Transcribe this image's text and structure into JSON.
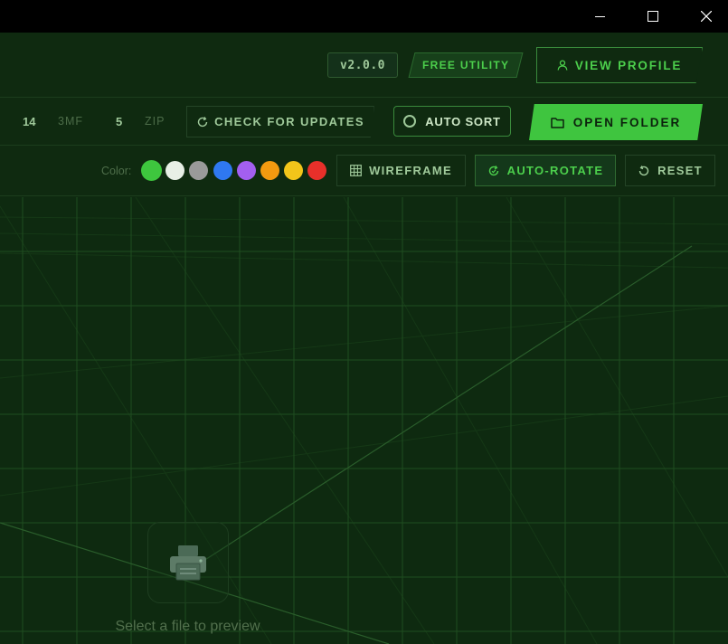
{
  "window": {
    "controls": {
      "minimize": "minimize-icon",
      "maximize": "maximize-icon",
      "close": "close-icon"
    }
  },
  "header": {
    "version": "v2.0.0",
    "badge": "FREE UTILITY",
    "profile_button": "VIEW PROFILE",
    "profile_icon": "user-icon"
  },
  "toolbar": {
    "stats": [
      {
        "count": "14",
        "label": "3MF"
      },
      {
        "count": "5",
        "label": "ZIP"
      }
    ],
    "check_updates": "CHECK FOR UPDATES",
    "auto_sort": "AUTO SORT",
    "open_folder": "OPEN FOLDER"
  },
  "viewbar": {
    "color_label": "Color:",
    "colors": [
      "#3ec63e",
      "#e8efe6",
      "#9a9a9a",
      "#2f78f0",
      "#a35ff0",
      "#f39a10",
      "#f2c51a",
      "#e8302a"
    ],
    "selected_color_index": 0,
    "wireframe": "WIREFRAME",
    "auto_rotate": "AUTO-ROTATE",
    "reset": "RESET"
  },
  "viewport": {
    "empty_icon": "printer-icon",
    "empty_text": "Select a file to preview"
  },
  "theme": {
    "accent": "#3fc53f",
    "background": "#0f2a10",
    "grid_line": "#1d4a1e"
  }
}
